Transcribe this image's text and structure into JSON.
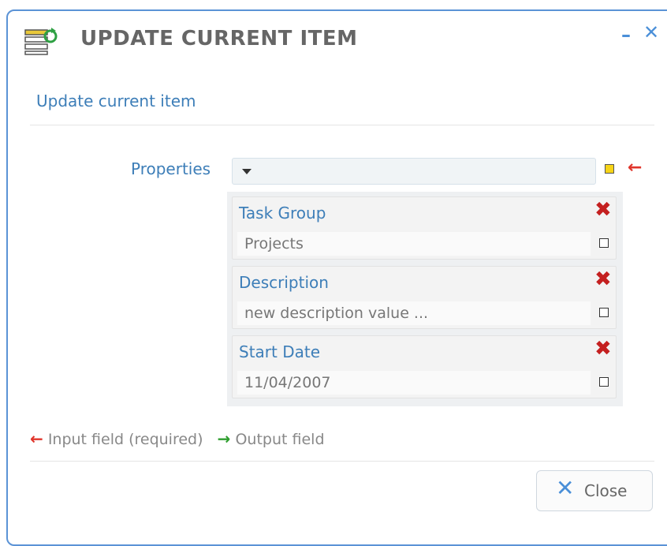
{
  "dialog": {
    "title": "UPDATE CURRENT ITEM",
    "subtitle": "Update current item",
    "minimize_symbol": "–",
    "close_symbol": "✕",
    "icon": "list-refresh-icon"
  },
  "properties": {
    "label": "Properties",
    "selected": "",
    "required_arrow": "←",
    "items": [
      {
        "label": "Task Group",
        "value": "Projects",
        "remove_symbol": "✖"
      },
      {
        "label": "Description",
        "value": "new description value ...",
        "remove_symbol": "✖"
      },
      {
        "label": "Start Date",
        "value": "11/04/2007",
        "remove_symbol": "✖"
      }
    ]
  },
  "legend": {
    "input_arrow": "←",
    "input_label": "Input field (required)",
    "output_arrow": "→",
    "output_label": "Output field"
  },
  "footer": {
    "close_symbol": "✕",
    "close_label": "Close"
  },
  "colors": {
    "accent": "#4a8fd8",
    "label_blue": "#3d7eb8",
    "required_red": "#e0352b",
    "output_green": "#2e9e2e",
    "remove_red": "#c42020"
  }
}
